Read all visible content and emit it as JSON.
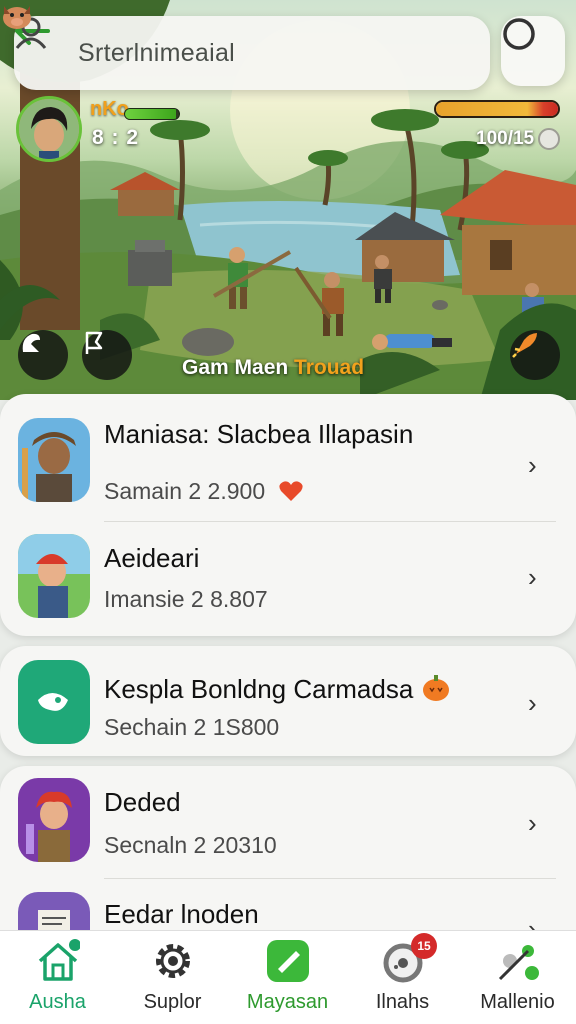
{
  "search": {
    "text": "Srterlnimeaial"
  },
  "player": {
    "name": "nKo",
    "score": "8 : 2",
    "health": 0.95
  },
  "enemy": {
    "score": "100/15",
    "health": 1.0
  },
  "scene": {
    "caption_white": "Gam Maen ",
    "caption_orange": "Trouad"
  },
  "list": [
    {
      "title": "Maniasa: Slacbea Illapasin",
      "subtitle": "Samain 2 2.900",
      "extra": "heart-icon"
    },
    {
      "title": "Aeideari",
      "subtitle": "Imansie 2 8.807"
    },
    {
      "title": "Kespla Bonldng Carmadsa",
      "subtitle": "Sechain 2 1S800",
      "extra": "pumpkin-icon"
    },
    {
      "title": "Deded",
      "subtitle": "Secnaln 2 20310"
    },
    {
      "title": "Eedar lnoden",
      "subtitle": ""
    }
  ],
  "nav": [
    {
      "label": "Ausha",
      "icon": "home-icon"
    },
    {
      "label": "Suplor",
      "icon": "gear-icon"
    },
    {
      "label": "Mayasan",
      "icon": "pencil-icon"
    },
    {
      "label": "Ilnahs",
      "icon": "disc-icon",
      "badge": "15"
    },
    {
      "label": "Mallenio",
      "icon": "share-icon"
    }
  ],
  "colors": {
    "accent_green": "#1aa36a",
    "badge_red": "#d42a2a",
    "highlight_orange": "#f3a21c"
  }
}
